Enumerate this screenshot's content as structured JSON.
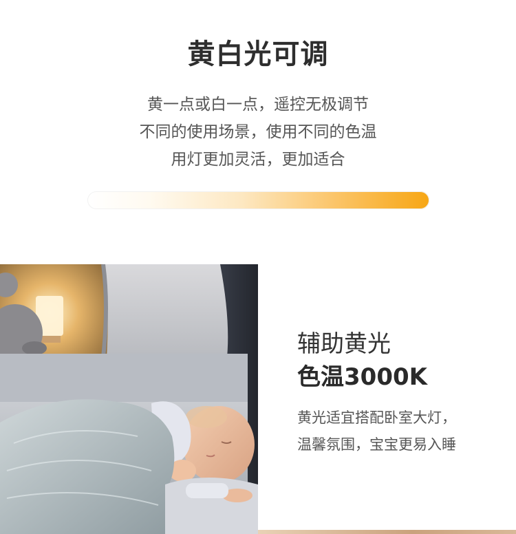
{
  "header": {
    "title": "黄白光可调",
    "description_lines": [
      "黄一点或白一点，遥控无极调节",
      "不同的使用场景，使用不同的色温",
      "用灯更加灵活，更加适合"
    ]
  },
  "color_temperature_bar": {
    "start_color": "#ffffff",
    "end_color": "#f7a613"
  },
  "feature": {
    "title_line1": "辅助黄光",
    "title_line2": "色温3000K",
    "desc_lines": [
      "黄光适宜搭配卧室大灯，",
      "温馨氛围，宝宝更易入睡"
    ],
    "image": "sleeping-baby-photo"
  }
}
